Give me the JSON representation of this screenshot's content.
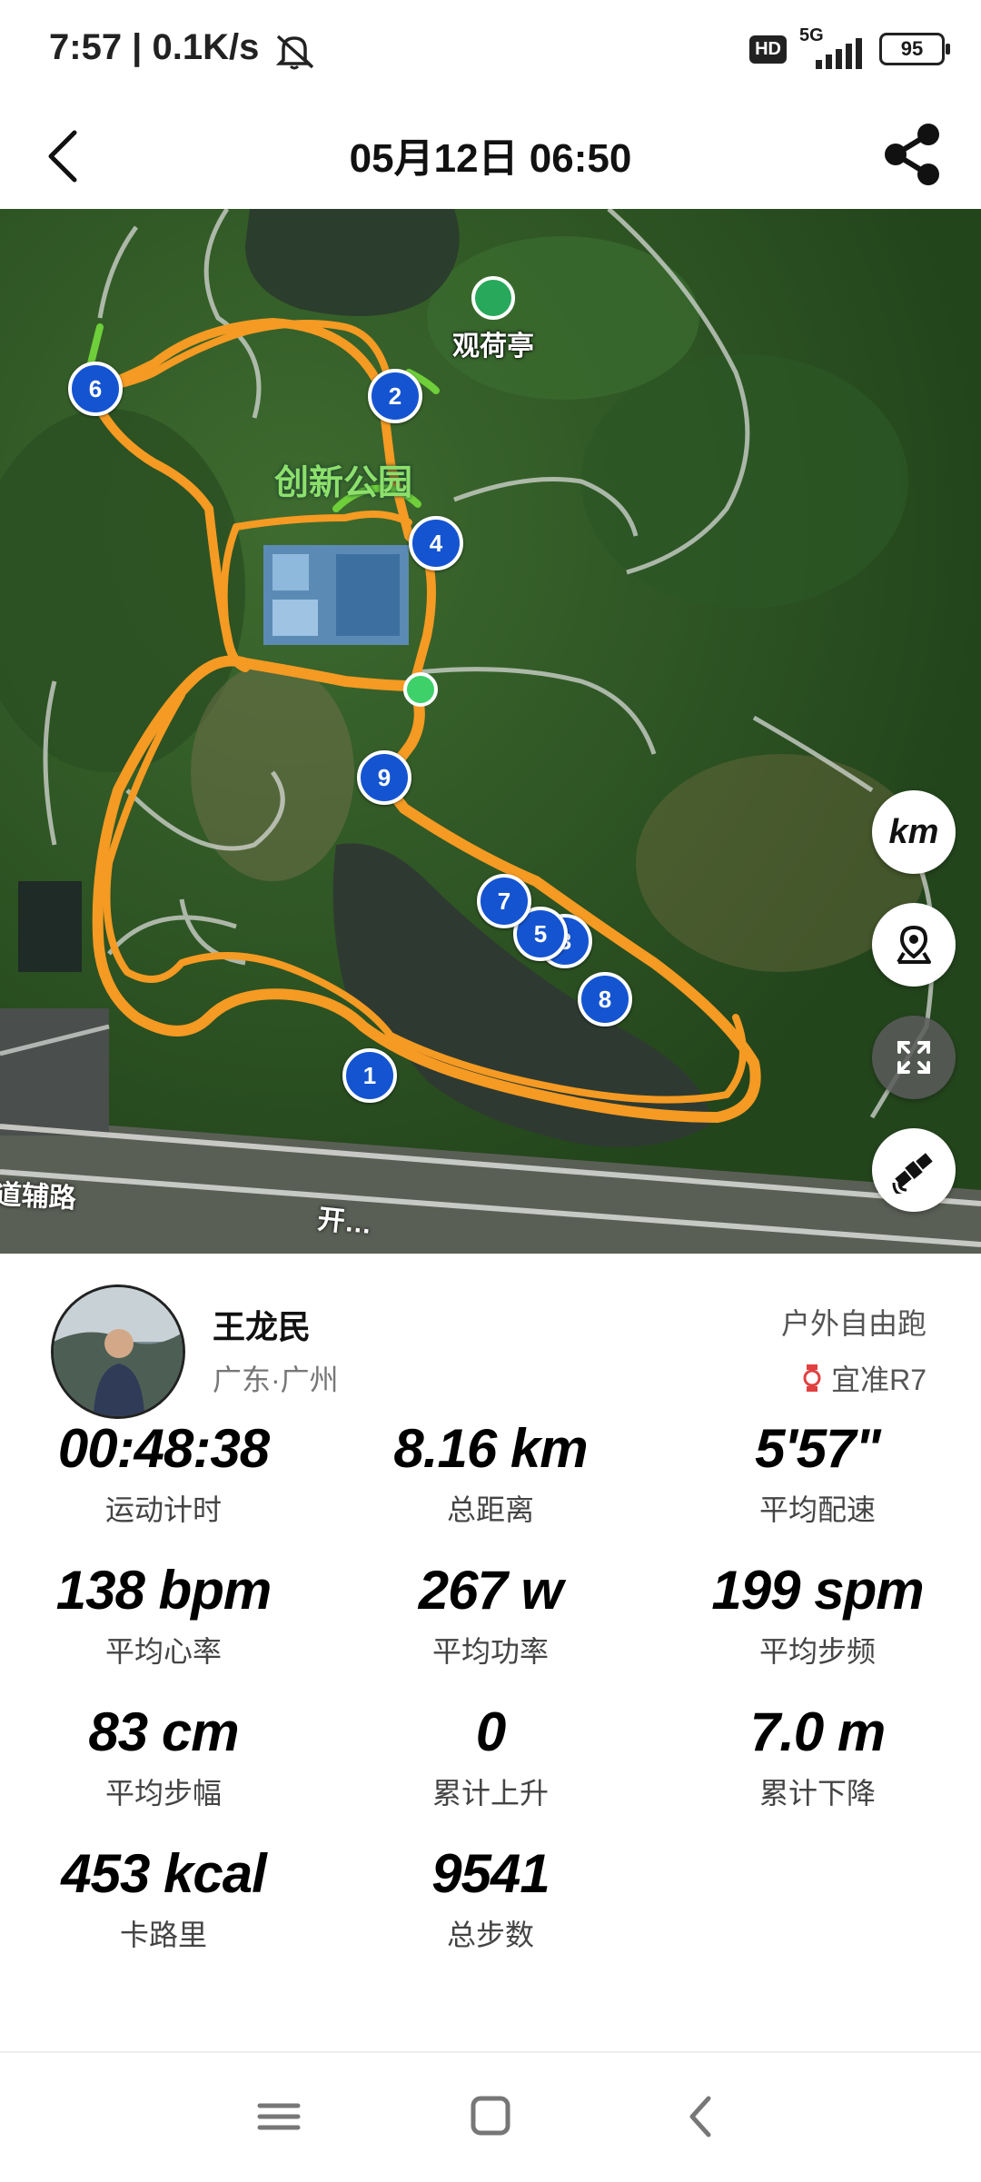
{
  "status_bar": {
    "time": "7:57 | 0.1K/s",
    "hd": "HD",
    "network": "5G",
    "battery": "95"
  },
  "header": {
    "title": "05月12日 06:50"
  },
  "map": {
    "poi_label": "观荷亭",
    "park_label": "创新公园",
    "road_label": "道辅路",
    "road_label_2": "开…",
    "units_toggle": "km",
    "lap_markers": [
      "1",
      "2",
      "3",
      "4",
      "5",
      "6",
      "7",
      "8",
      "9"
    ]
  },
  "profile": {
    "name": "王龙民",
    "location": "广东·广州",
    "sport_type": "户外自由跑",
    "device": "宜准R7"
  },
  "stats": [
    {
      "value": "00:48:38",
      "label": "运动计时"
    },
    {
      "value": "8.16 km",
      "label": "总距离"
    },
    {
      "value": "5'57\"",
      "label": "平均配速"
    },
    {
      "value": "138 bpm",
      "label": "平均心率"
    },
    {
      "value": "267 w",
      "label": "平均功率"
    },
    {
      "value": "199 spm",
      "label": "平均步频"
    },
    {
      "value": "83 cm",
      "label": "平均步幅"
    },
    {
      "value": "0",
      "label": "累计上升"
    },
    {
      "value": "7.0 m",
      "label": "累计下降"
    },
    {
      "value": "453 kcal",
      "label": "卡路里"
    },
    {
      "value": "9541",
      "label": "总步数"
    }
  ],
  "colors": {
    "route": "#f59a23",
    "lap_marker": "#1554d1",
    "start": "#3ed16a",
    "map_forest": "#2f5a26"
  },
  "icons": {
    "back": "back-arrow-icon",
    "share": "share-icon",
    "location": "location-pin-icon",
    "fullscreen": "fullscreen-icon",
    "satellite": "satellite-icon"
  }
}
